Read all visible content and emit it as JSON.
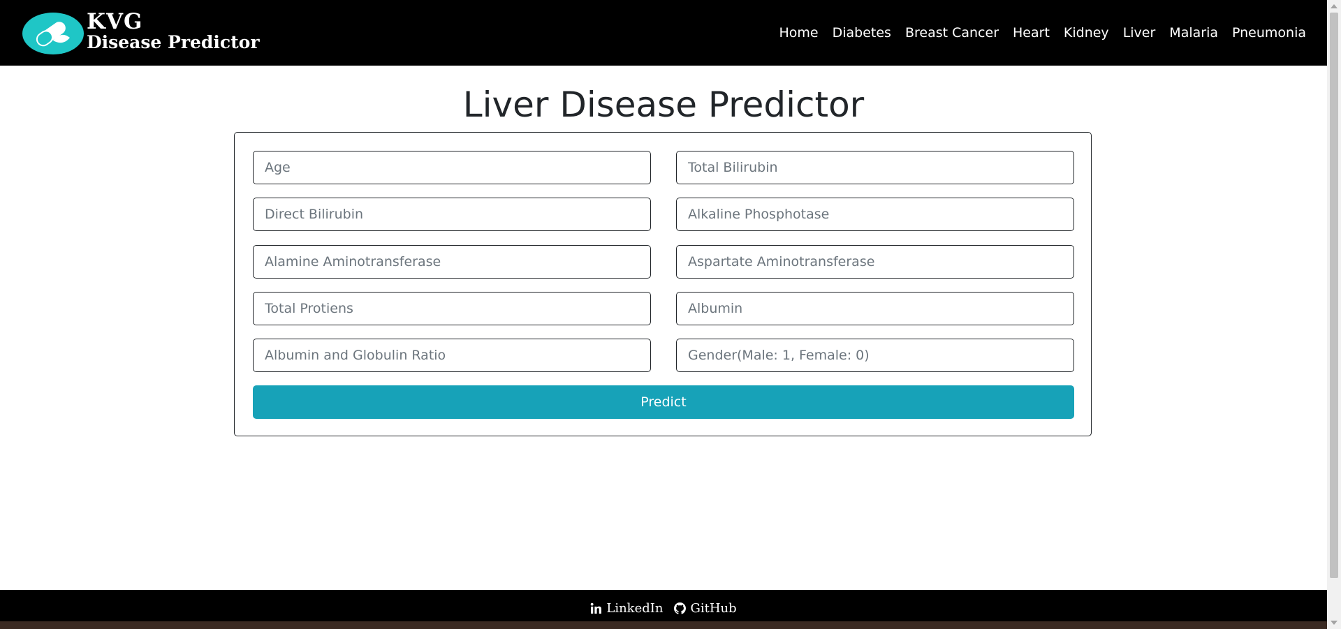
{
  "brand": {
    "line1": "KVG",
    "line2": "Disease Predictor",
    "colors": {
      "pill_teal": "#1fc6c6",
      "pill_white": "#ffffff"
    }
  },
  "nav": {
    "items": [
      {
        "label": "Home"
      },
      {
        "label": "Diabetes"
      },
      {
        "label": "Breast Cancer"
      },
      {
        "label": "Heart"
      },
      {
        "label": "Kidney"
      },
      {
        "label": "Liver"
      },
      {
        "label": "Malaria"
      },
      {
        "label": "Pneumonia"
      }
    ]
  },
  "page": {
    "title": "Liver Disease Predictor"
  },
  "form": {
    "fields": [
      {
        "placeholder": "Age"
      },
      {
        "placeholder": "Total Bilirubin"
      },
      {
        "placeholder": "Direct Bilirubin"
      },
      {
        "placeholder": "Alkaline Phosphotase"
      },
      {
        "placeholder": "Alamine Aminotransferase"
      },
      {
        "placeholder": "Aspartate Aminotransferase"
      },
      {
        "placeholder": "Total Protiens"
      },
      {
        "placeholder": "Albumin"
      },
      {
        "placeholder": "Albumin and Globulin Ratio"
      },
      {
        "placeholder": "Gender(Male: 1, Female: 0)"
      }
    ],
    "submit_label": "Predict",
    "submit_color": "#17a2b8"
  },
  "footer": {
    "linkedin_label": "LinkedIn",
    "github_label": "GitHub"
  }
}
